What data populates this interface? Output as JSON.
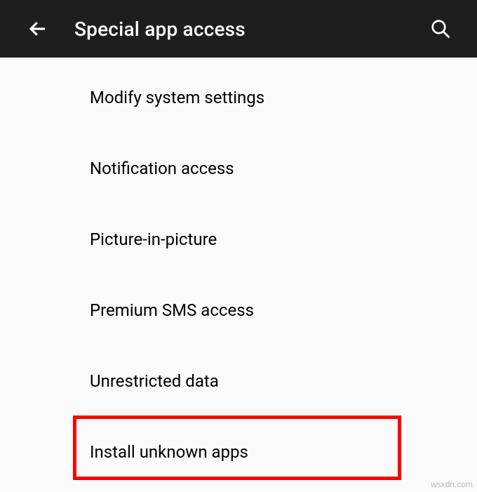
{
  "header": {
    "title": "Special app access"
  },
  "list": {
    "items": [
      {
        "label": "Modify system settings"
      },
      {
        "label": "Notification access"
      },
      {
        "label": "Picture-in-picture"
      },
      {
        "label": "Premium SMS access"
      },
      {
        "label": "Unrestricted data"
      },
      {
        "label": "Install unknown apps"
      }
    ]
  },
  "watermark": "wsxdn.com"
}
